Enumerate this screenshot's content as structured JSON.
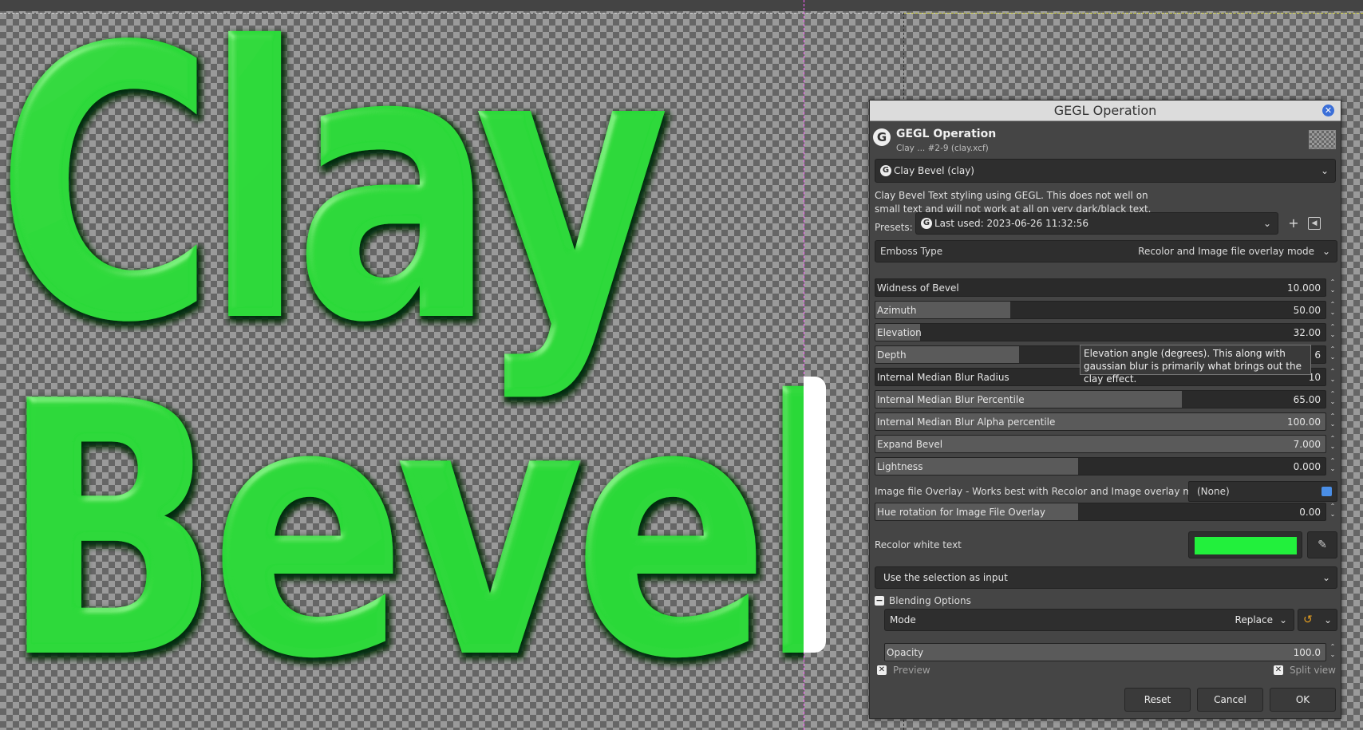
{
  "canvas": {
    "text_line1": "Clay",
    "text_line2": "Bevel",
    "text_color": "#2fd93a"
  },
  "dialog": {
    "window_title": "GEGL Operation",
    "header_title": "GEGL Operation",
    "header_subtitle": "Clay ... #2-9 (clay.xcf)",
    "operation": "Clay Bevel (clay)",
    "description": "Clay Bevel Text styling using GEGL. This does not well on small text and will not work at all on very dark/black text.",
    "presets_label": "Presets:",
    "preset_value": "Last used: 2023-06-26 11:32:56",
    "emboss_type": {
      "label": "Emboss Type",
      "value": "Recolor and Image file overlay mode"
    },
    "params": [
      {
        "label": "Widness of Bevel",
        "value": "10.000",
        "fill": 0.0
      },
      {
        "label": "Azimuth",
        "value": "50.00",
        "fill": 0.3
      },
      {
        "label": "Elevation",
        "value": "32.00",
        "fill": 0.1
      },
      {
        "label": "Depth",
        "value": "6",
        "fill": 0.32
      },
      {
        "label": "Internal Median Blur Radius",
        "value": "10",
        "fill": 0.0
      },
      {
        "label": "Internal Median Blur Percentile",
        "value": "65.00",
        "fill": 0.68
      },
      {
        "label": "Internal Median Blur Alpha percentile",
        "value": "100.00",
        "fill": 1.0
      },
      {
        "label": "Expand Bevel",
        "value": "7.000",
        "fill": 1.0
      },
      {
        "label": "Lightness",
        "value": "0.000",
        "fill": 0.45
      }
    ],
    "tooltip": "Elevation angle (degrees). This along with gaussian blur is primarily what brings out the clay effect.",
    "overlay_label": "Image file Overlay - Works best with Recolor and Image overlay mode",
    "overlay_value": "(None)",
    "hue_rotation": {
      "label": "Hue rotation for Image File Overlay",
      "value": "0.00",
      "fill": 0.45
    },
    "recolor_label": "Recolor white text",
    "recolor_color": "#22f03c",
    "selection_input": "Use the selection as input",
    "blending_label": "Blending Options",
    "mode_label": "Mode",
    "mode_value": "Replace",
    "opacity": {
      "label": "Opacity",
      "value": "100.0",
      "fill": 1.0
    },
    "preview_label": "Preview",
    "split_view_label": "Split view",
    "buttons": {
      "reset": "Reset",
      "cancel": "Cancel",
      "ok": "OK"
    }
  }
}
